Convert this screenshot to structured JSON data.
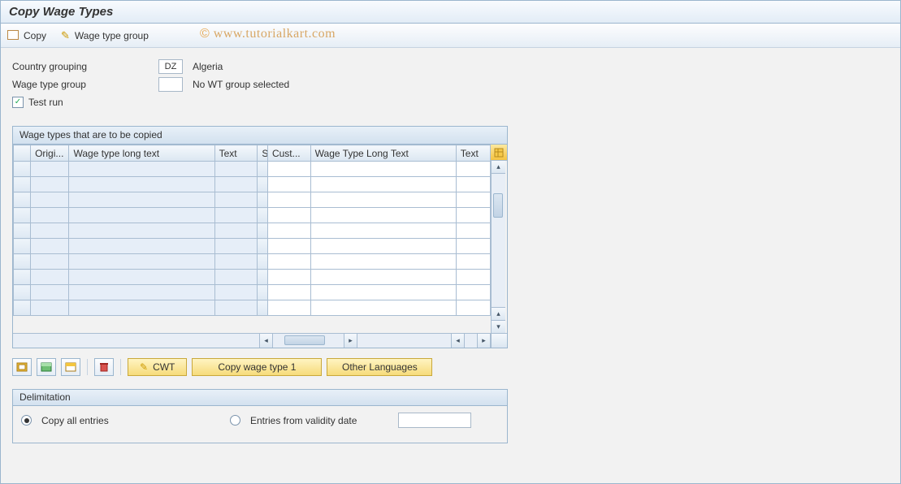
{
  "title": "Copy Wage Types",
  "watermark": "© www.tutorialkart.com",
  "toolbar": {
    "copy_label": "Copy",
    "wtg_label": "Wage type group"
  },
  "form": {
    "country_label": "Country grouping",
    "country_code": "DZ",
    "country_name": "Algeria",
    "wtg_label": "Wage type group",
    "wtg_code": "",
    "wtg_desc": "No WT group selected",
    "testrun_label": "Test run",
    "testrun_checked": true
  },
  "table": {
    "title": "Wage types that are to be copied",
    "cols": {
      "c1": "Origi...",
      "c2": "Wage type long text",
      "c3": "Text",
      "c4": "S",
      "c5": "Cust...",
      "c6": "Wage Type Long Text",
      "c7": "Text"
    },
    "row_count": 10
  },
  "buttons": {
    "cwt": "CWT",
    "copy1": "Copy wage type 1",
    "other_lang": "Other Languages"
  },
  "delimitation": {
    "title": "Delimitation",
    "opt_all": "Copy all entries",
    "opt_from": "Entries from validity date",
    "selected": "all",
    "date_value": ""
  }
}
